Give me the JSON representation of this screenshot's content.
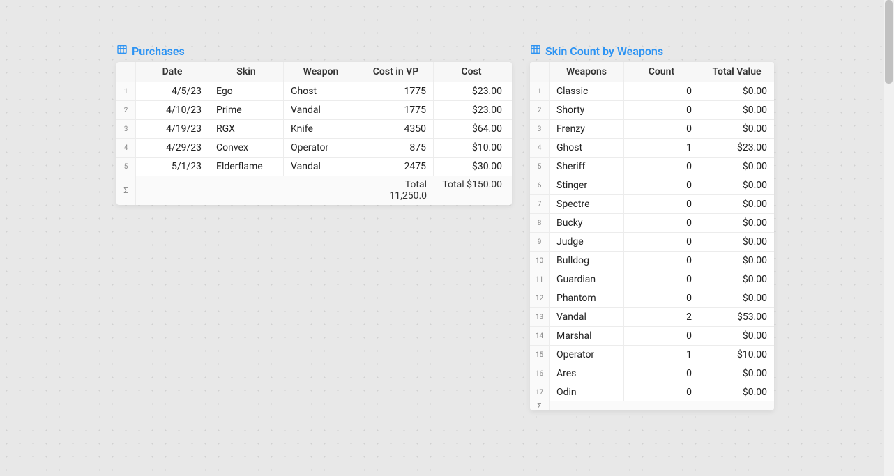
{
  "purchases": {
    "title": "Purchases",
    "headers": {
      "date": "Date",
      "skin": "Skin",
      "weapon": "Weapon",
      "vp": "Cost in VP",
      "cost": "Cost"
    },
    "rows": [
      {
        "date": "4/5/23",
        "skin": "Ego",
        "weapon": "Ghost",
        "vp": "1775",
        "cost": "$23.00"
      },
      {
        "date": "4/10/23",
        "skin": "Prime",
        "weapon": "Vandal",
        "vp": "1775",
        "cost": "$23.00"
      },
      {
        "date": "4/19/23",
        "skin": "RGX",
        "weapon": "Knife",
        "vp": "4350",
        "cost": "$64.00"
      },
      {
        "date": "4/29/23",
        "skin": "Convex",
        "weapon": "Operator",
        "vp": "875",
        "cost": "$10.00"
      },
      {
        "date": "5/1/23",
        "skin": "Elderflame",
        "weapon": "Vandal",
        "vp": "2475",
        "cost": "$30.00"
      }
    ],
    "totals": {
      "vp_label": "Total 11,250.0",
      "cost_label": "Total $150.00"
    },
    "sigma": "Σ"
  },
  "weapons": {
    "title": "Skin Count by Weapons",
    "headers": {
      "weapon": "Weapons",
      "count": "Count",
      "value": "Total Value"
    },
    "rows": [
      {
        "weapon": "Classic",
        "count": "0",
        "value": "$0.00"
      },
      {
        "weapon": "Shorty",
        "count": "0",
        "value": "$0.00"
      },
      {
        "weapon": "Frenzy",
        "count": "0",
        "value": "$0.00"
      },
      {
        "weapon": "Ghost",
        "count": "1",
        "value": "$23.00"
      },
      {
        "weapon": "Sheriff",
        "count": "0",
        "value": "$0.00"
      },
      {
        "weapon": "Stinger",
        "count": "0",
        "value": "$0.00"
      },
      {
        "weapon": "Spectre",
        "count": "0",
        "value": "$0.00"
      },
      {
        "weapon": "Bucky",
        "count": "0",
        "value": "$0.00"
      },
      {
        "weapon": "Judge",
        "count": "0",
        "value": "$0.00"
      },
      {
        "weapon": "Bulldog",
        "count": "0",
        "value": "$0.00"
      },
      {
        "weapon": "Guardian",
        "count": "0",
        "value": "$0.00"
      },
      {
        "weapon": "Phantom",
        "count": "0",
        "value": "$0.00"
      },
      {
        "weapon": "Vandal",
        "count": "2",
        "value": "$53.00"
      },
      {
        "weapon": "Marshal",
        "count": "0",
        "value": "$0.00"
      },
      {
        "weapon": "Operator",
        "count": "1",
        "value": "$10.00"
      },
      {
        "weapon": "Ares",
        "count": "0",
        "value": "$0.00"
      },
      {
        "weapon": "Odin",
        "count": "0",
        "value": "$0.00"
      }
    ],
    "sigma": "Σ"
  }
}
